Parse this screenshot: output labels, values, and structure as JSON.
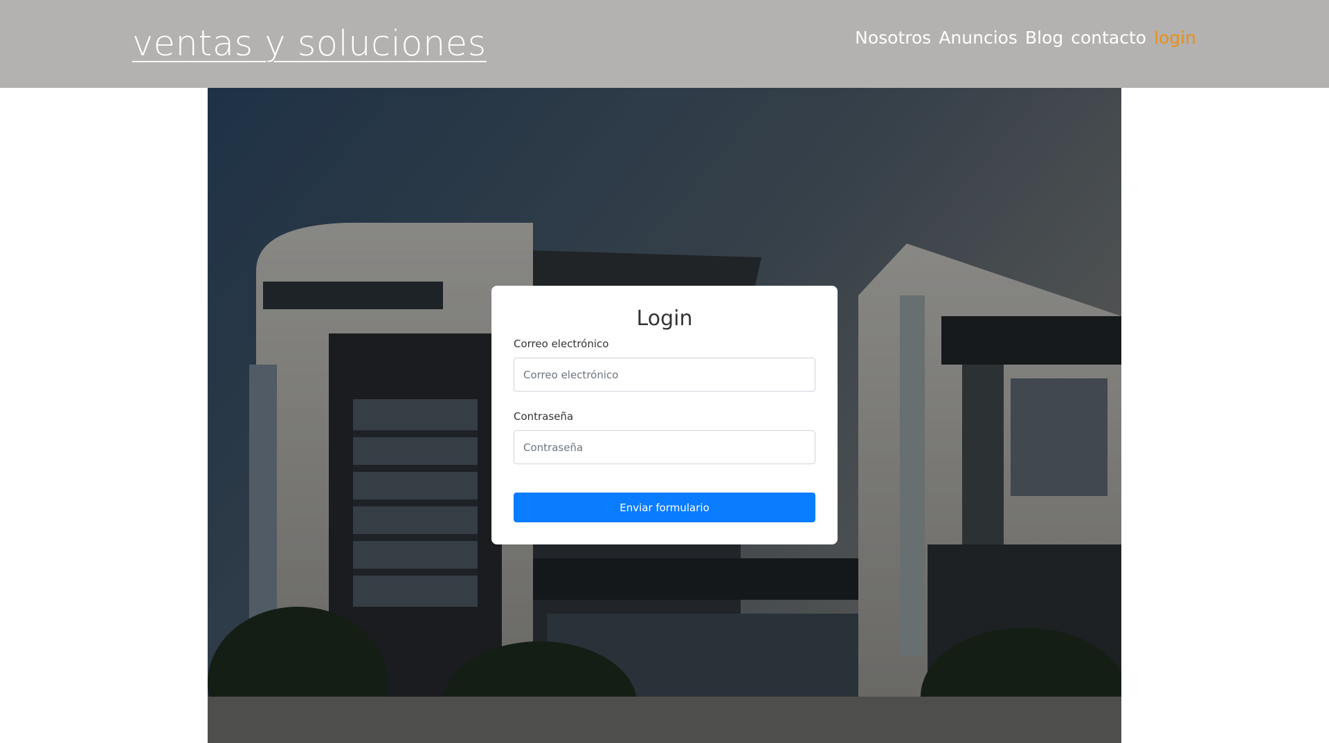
{
  "header": {
    "brand": "ventas y soluciones",
    "nav": [
      {
        "label": "Nosotros"
      },
      {
        "label": "Anuncios"
      },
      {
        "label": "Blog"
      },
      {
        "label": "contacto"
      },
      {
        "label": "login"
      }
    ],
    "active_color": "#e8901a"
  },
  "login": {
    "title": "Login",
    "email_label": "Correo electrónico",
    "email_placeholder": "Correo electrónico",
    "password_label": "Contraseña",
    "password_placeholder": "Contraseña",
    "submit_label": "Enviar formulario",
    "submit_color": "#0a7cff"
  }
}
